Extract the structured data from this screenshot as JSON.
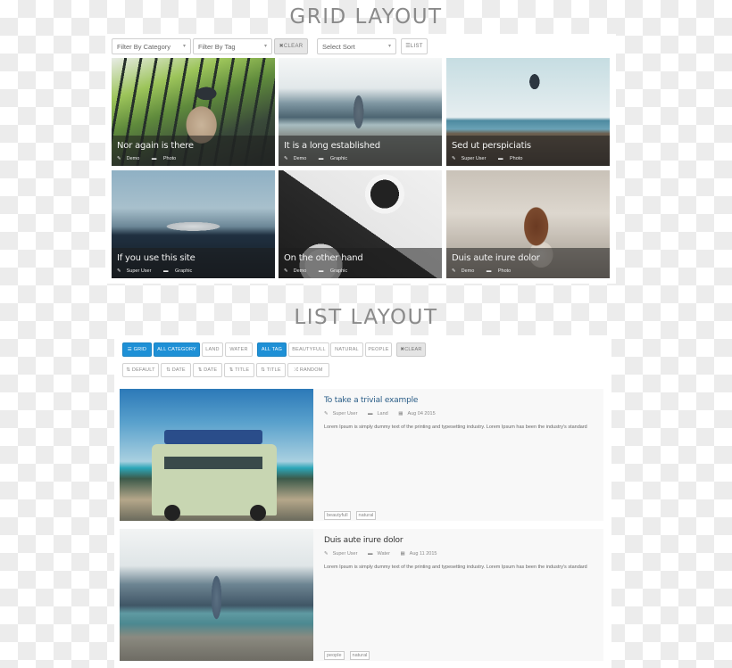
{
  "grid_section": {
    "title": "GRID LAYOUT",
    "toolbar": {
      "category_select": "Filter By Category",
      "tag_select": "Filter By Tag",
      "clear_label": "CLEAR",
      "sort_select": "Select Sort",
      "list_label": "LIST"
    },
    "cards": [
      {
        "title": "Nor again is there",
        "author": "Demo",
        "category": "Photo"
      },
      {
        "title": "It is a long established",
        "author": "Demo",
        "category": "Graphic"
      },
      {
        "title": "Sed ut perspiciatis",
        "author": "Super User",
        "category": "Photo"
      },
      {
        "title": "If you use this site",
        "author": "Super User",
        "category": "Graphic"
      },
      {
        "title": "On the other hand",
        "author": "Demo",
        "category": "Graphic"
      },
      {
        "title": "Duis aute irure dolor",
        "author": "Demo",
        "category": "Photo"
      }
    ]
  },
  "list_section": {
    "title": "LIST LAYOUT",
    "filters": {
      "grid": "GRID",
      "all_category": "ALL CATEGORY",
      "land": "LAND",
      "water": "WATER",
      "all_tag": "ALL TAG",
      "beautyfull": "BEAUTYFULL",
      "natural": "NATURAL",
      "people": "PEOPLE",
      "clear": "CLEAR"
    },
    "sorts": {
      "default": "DEFAULT",
      "date_asc": "DATE",
      "date_desc": "DATE",
      "title_asc": "TITLE",
      "title_desc": "TITLE",
      "random": "RANDOM"
    },
    "items": [
      {
        "title": "To take a trivial example",
        "author": "Super User",
        "category": "Land",
        "date": "Aug 04 2015",
        "description": "Lorem Ipsum is simply dummy text of the printing and typesetting industry. Lorem Ipsum has been the industry's standard",
        "tags": [
          "beautyfull",
          "natural"
        ]
      },
      {
        "title": "Duis aute irure dolor",
        "author": "Super User",
        "category": "Water",
        "date": "Aug 11 2015",
        "description": "Lorem Ipsum is simply dummy text of the printing and typesetting industry. Lorem Ipsum has been the industry's standard",
        "tags": [
          "people",
          "natural"
        ]
      }
    ]
  },
  "icons": {
    "pencil": "✎",
    "folder": "▬",
    "calendar": "▦",
    "caret": "▾",
    "times": "✖",
    "list": "☰",
    "sort": "⇅",
    "shuffle": "⤮"
  },
  "colors": {
    "accent": "#1e90d6",
    "title_grey": "#8a8a8a",
    "list_title_link": "#2a5d87"
  }
}
